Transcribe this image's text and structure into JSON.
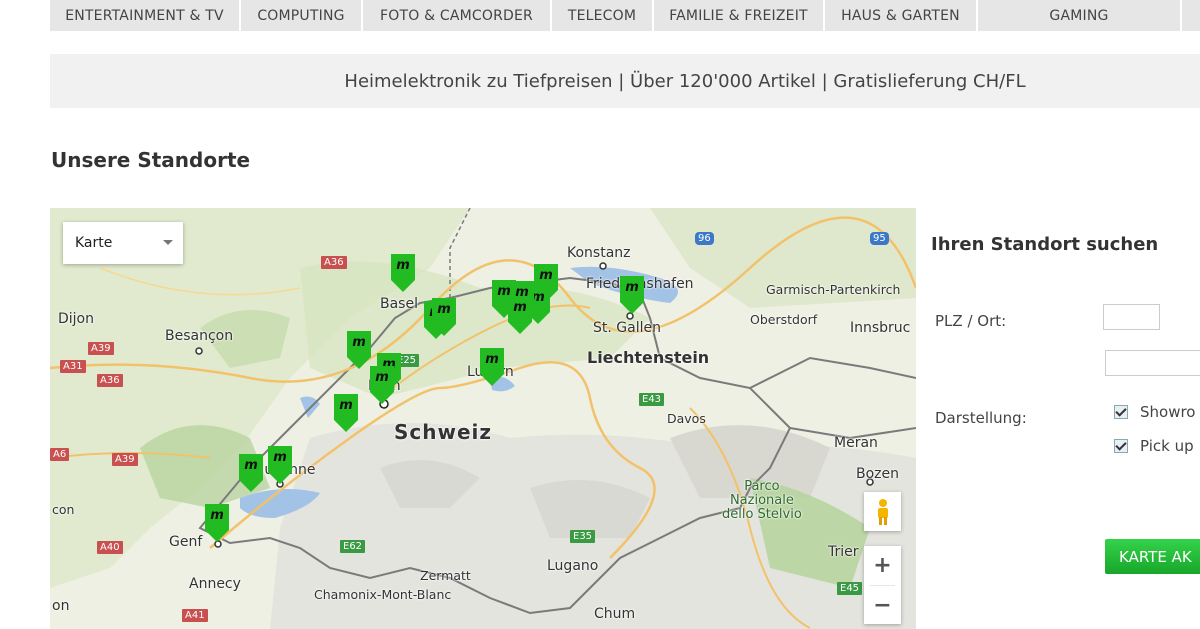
{
  "nav": {
    "items": [
      {
        "label": "ENTERTAINMENT & TV"
      },
      {
        "label": "COMPUTING"
      },
      {
        "label": "FOTO & CAMCORDER"
      },
      {
        "label": "TELECOM"
      },
      {
        "label": "FAMILIE & FREIZEIT"
      },
      {
        "label": "HAUS & GARTEN"
      },
      {
        "label": "GAMING"
      }
    ]
  },
  "banner": {
    "text": "Heimelektronik zu Tiefpreisen | Über 120'000 Artikel | Gratislieferung CH/FL"
  },
  "section_title": "Unsere Standorte",
  "map": {
    "type_select": "Karte",
    "marker_letter": "m",
    "zoom_in": "+",
    "zoom_out": "−",
    "labels": {
      "schweiz": "Schweiz",
      "liechtenstein": "Liechtenstein",
      "konstanz": "Konstanz",
      "friedrichshafen": "Friedrichshafen",
      "garmisch": "Garmisch-Partenkirch",
      "oberstdorf": "Oberstdorf",
      "innsbruck": "Innsbruc",
      "stgallen": "St. Gallen",
      "basel": "Basel",
      "dijon": "Dijon",
      "besancon": "Besançon",
      "bern": "Bern",
      "luzern": "Luzern",
      "davos": "Davos",
      "meran": "Meran",
      "bozen": "Bozen",
      "parco": "Parco\nNazionale\ndello Stelvio",
      "lausanne": "Lausanne",
      "genf": "Genf",
      "annecy": "Annecy",
      "zermatt": "Zermatt",
      "chamonix": "Chamonix-Mont-Blanc",
      "lugano": "Lugano",
      "chum": "Chum",
      "trient": "Trier",
      "con": "con",
      "on": "on"
    },
    "roads": {
      "a36_top": "A36",
      "a36_left": "A36",
      "a39": "A39",
      "a39b": "A39",
      "a31": "A31",
      "a40": "A40",
      "a41": "A41",
      "a6": "A6",
      "e25": "E25",
      "e43": "E43",
      "e62": "E62",
      "e35": "E35",
      "e45": "E45",
      "r96": "96",
      "r95": "95"
    }
  },
  "sidebar": {
    "title": "Ihren Standort suchen",
    "plz_label": "PLZ / Ort:",
    "plz_value": "",
    "ort_value": "",
    "display_label": "Darstellung:",
    "showroom_label": "Showro",
    "pickup_label": "Pick up",
    "button_label": "KARTE AK"
  },
  "colors": {
    "marker": "#22bb22",
    "button": "#22b632",
    "nav_bg": "#e6e6e6",
    "banner_bg": "#f1f1f1"
  }
}
